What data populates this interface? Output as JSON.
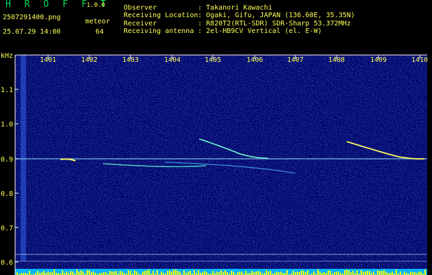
{
  "app": {
    "name": "H R O F F T",
    "version": "1.0.0"
  },
  "file": {
    "name": "2507291400.png",
    "datetime": "25.07.29 14:00"
  },
  "meteor": {
    "label": "meteor",
    "count": "64"
  },
  "info": [
    {
      "label": "Observer",
      "value": ": Takanori Kawachi"
    },
    {
      "label": "Receiving Location",
      "value": ": Ogaki, Gifu, JAPAN (136.60E, 35.35N)"
    },
    {
      "label": "Receiver",
      "value": ": R820T2(RTL-SDR) SDR-Sharp 53.372MHz"
    },
    {
      "label": "Receiving antenna",
      "value": ": 2el-HB9CV Vertical (el. E-W)"
    }
  ],
  "axis": {
    "y_unit": "kHz",
    "x_ticks": [
      "1401",
      "1402",
      "1403",
      "1404",
      "1405",
      "1406",
      "1407",
      "1408",
      "1409",
      "1410"
    ],
    "y_ticks": [
      "1.1",
      "1.0",
      "0.9",
      "0.8",
      "0.7",
      "0.6"
    ]
  },
  "colors": {
    "background": "#000066",
    "signal": "#ffff00",
    "text_yellow": "#ffff55",
    "title_green": "#00e05a"
  }
}
